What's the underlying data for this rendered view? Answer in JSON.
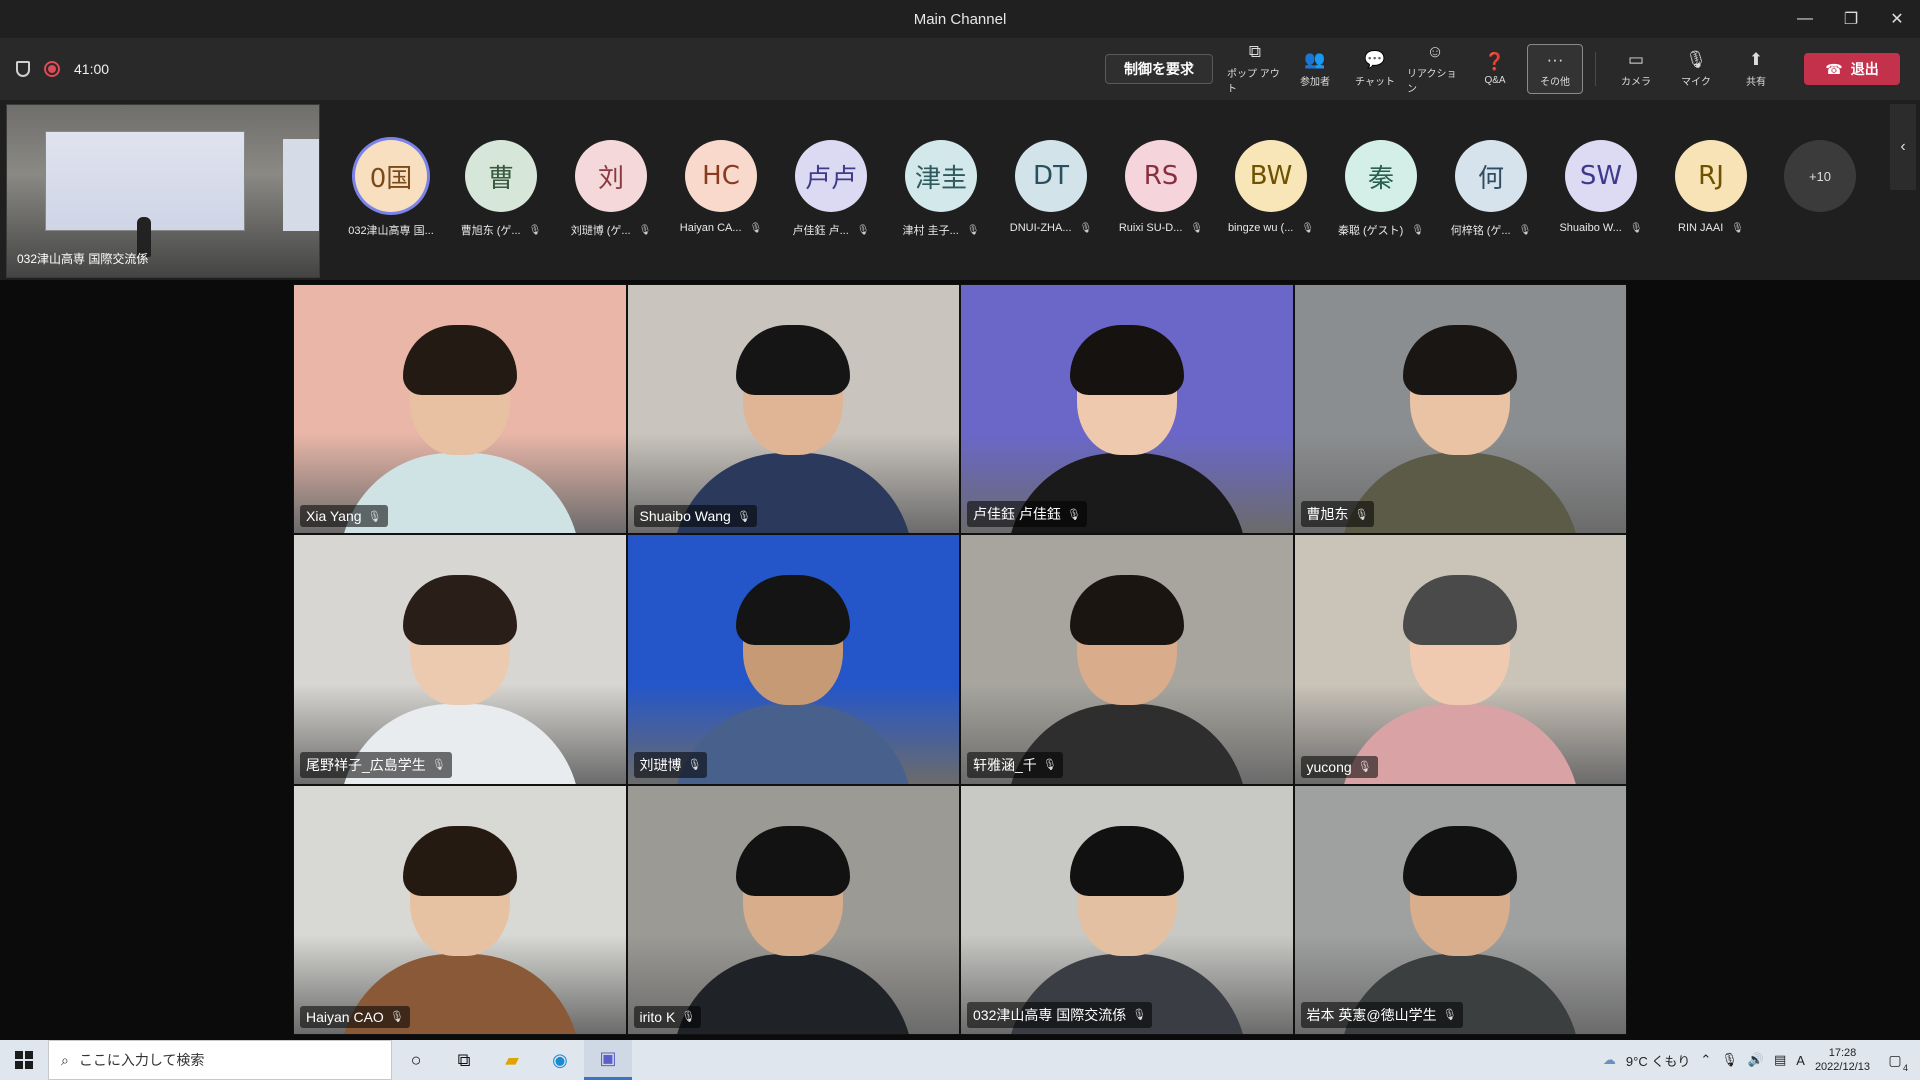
{
  "window": {
    "title": "Main Channel"
  },
  "toolbar": {
    "timer": "41:00",
    "request_control": "制御を要求",
    "tools": [
      {
        "icon": "popout-icon",
        "glyph": "⧉",
        "label": "ポップ アウト"
      },
      {
        "icon": "people-icon",
        "glyph": "👥",
        "label": "参加者"
      },
      {
        "icon": "chat-icon",
        "glyph": "💬",
        "label": "チャット"
      },
      {
        "icon": "reaction-icon",
        "glyph": "☺",
        "label": "リアクション"
      },
      {
        "icon": "qa-icon",
        "glyph": "❓",
        "label": "Q&A"
      },
      {
        "icon": "more-icon",
        "glyph": "···",
        "label": "その他"
      }
    ],
    "devices": [
      {
        "icon": "camera-off-icon",
        "glyph": "▭",
        "label": "カメラ"
      },
      {
        "icon": "mic-off-icon",
        "glyph": "🎙",
        "label": "マイク"
      },
      {
        "icon": "share-icon",
        "glyph": "⬆",
        "label": "共有"
      }
    ],
    "leave_label": "退出"
  },
  "stage": {
    "caption": "032津山高専 国際交流係"
  },
  "roster": [
    {
      "initials": "0国",
      "name": "032津山高専 国...",
      "bg": "#f7dfc0",
      "fg": "#7a4a1a",
      "active": true,
      "mic": false
    },
    {
      "initials": "曹",
      "name": "曹旭东 (ゲ...",
      "bg": "#d6e6d9",
      "fg": "#3b5a3f",
      "active": false,
      "mic": true
    },
    {
      "initials": "刘",
      "name": "刘琎博 (ゲ...",
      "bg": "#f5d9da",
      "fg": "#8a3a3f",
      "active": false,
      "mic": true
    },
    {
      "initials": "HC",
      "name": "Haiyan CA...",
      "bg": "#f8d9cc",
      "fg": "#8a3a1f",
      "active": false,
      "mic": true
    },
    {
      "initials": "卢卢",
      "name": "卢佳鈺 卢...",
      "bg": "#dcdaf2",
      "fg": "#3f3a8a",
      "active": false,
      "mic": true
    },
    {
      "initials": "津圭",
      "name": "津村 圭子...",
      "bg": "#d3e8ea",
      "fg": "#2f5a5e",
      "active": false,
      "mic": true
    },
    {
      "initials": "DT",
      "name": "DNUI-ZHA...",
      "bg": "#d2e4ea",
      "fg": "#2a4f5e",
      "active": false,
      "mic": true
    },
    {
      "initials": "RS",
      "name": "Ruixi SU-D...",
      "bg": "#f5d5db",
      "fg": "#8a2f3f",
      "active": false,
      "mic": true
    },
    {
      "initials": "BW",
      "name": "bingze wu (...",
      "bg": "#f8e6b8",
      "fg": "#6e5200",
      "active": false,
      "mic": true
    },
    {
      "initials": "秦",
      "name": "秦聪 (ゲスト)",
      "bg": "#d4eee8",
      "fg": "#2a6050",
      "active": false,
      "mic": true
    },
    {
      "initials": "何",
      "name": "何梓铭 (ゲ...",
      "bg": "#d6e3ec",
      "fg": "#2f4e66",
      "active": false,
      "mic": true
    },
    {
      "initials": "SW",
      "name": "Shuaibo W...",
      "bg": "#dcdbf3",
      "fg": "#3d3a8e",
      "active": false,
      "mic": true
    },
    {
      "initials": "RJ",
      "name": "RIN JAAI",
      "bg": "#f8e3b6",
      "fg": "#6e5000",
      "active": false,
      "mic": true
    }
  ],
  "roster_more": "+10",
  "tiles": [
    {
      "name": "Xia Yang",
      "bg": "#e9b6a8",
      "skin": "#e8c0a2",
      "hair": "#241a14",
      "shirt": "#cfe2e4"
    },
    {
      "name": "Shuaibo Wang",
      "bg": "#c9c4bd",
      "skin": "#e0b595",
      "hair": "#151515",
      "shirt": "#2b3a5c"
    },
    {
      "name": "卢佳鈺 卢佳鈺",
      "bg": "#6a67c9",
      "skin": "#efc9ad",
      "hair": "#161210",
      "shirt": "#1a1a1a"
    },
    {
      "name": "曹旭东",
      "bg": "#8b8e90",
      "skin": "#e9c3a3",
      "hair": "#1a1613",
      "shirt": "#5b5b48"
    },
    {
      "name": "尾野祥子_広島学生",
      "bg": "#d8d6d2",
      "skin": "#eccab0",
      "hair": "#2a1e18",
      "shirt": "#e8ecef"
    },
    {
      "name": "刘琎博",
      "bg": "#2456c9",
      "skin": "#c79a76",
      "hair": "#141414",
      "shirt": "#48618c"
    },
    {
      "name": "轩雅涵_千",
      "bg": "#a7a59e",
      "skin": "#d9ac8b",
      "hair": "#1b1512",
      "shirt": "#2e2e2e"
    },
    {
      "name": "yucong",
      "bg": "#c9c3b8",
      "skin": "#efcab0",
      "hair": "#4a4a4a",
      "shirt": "#d9a2a5"
    },
    {
      "name": "Haiyan CAO",
      "bg": "#d8d8d4",
      "skin": "#e7c2a2",
      "hair": "#251a12",
      "shirt": "#8a5a38"
    },
    {
      "name": "irito K",
      "bg": "#9c9a95",
      "skin": "#d7ad8c",
      "hair": "#121212",
      "shirt": "#1f2328"
    },
    {
      "name": "032津山高専 国際交流係",
      "bg": "#c8c9c5",
      "skin": "#e3c0a2",
      "hair": "#111111",
      "shirt": "#3b3d44"
    },
    {
      "name": "岩本 英憲@徳山学生",
      "bg": "#9fa1a0",
      "skin": "#d9ae8c",
      "hair": "#121212",
      "shirt": "#3c3f40"
    }
  ],
  "taskbar": {
    "search_placeholder": "ここに入力して検索",
    "weather": "9°C くもり",
    "time": "17:28",
    "date": "2022/12/13",
    "notif_count": "4"
  }
}
